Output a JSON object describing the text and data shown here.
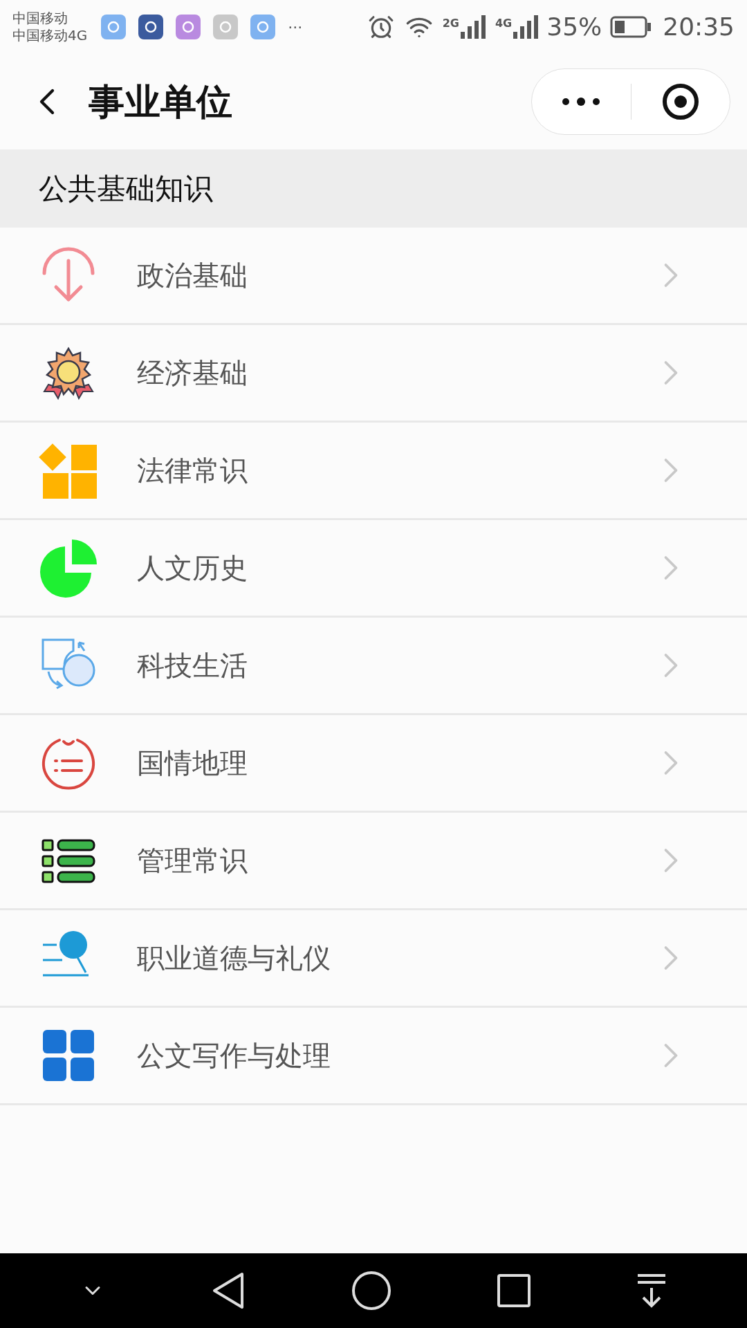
{
  "status_bar": {
    "carriers": [
      "中国移动",
      "中国移动4G"
    ],
    "more": "···",
    "networks": [
      "2G",
      "4G"
    ],
    "battery_text": "35%",
    "time": "20:35"
  },
  "nav_bar": {
    "title": "事业单位"
  },
  "section": {
    "title": "公共基础知识"
  },
  "items": [
    {
      "label": "政治基础",
      "kind": "arrow-down"
    },
    {
      "label": "经济基础",
      "kind": "medal"
    },
    {
      "label": "法律常识",
      "kind": "blocks"
    },
    {
      "label": "人文历史",
      "kind": "pie"
    },
    {
      "label": "科技生活",
      "kind": "shapes"
    },
    {
      "label": "国情地理",
      "kind": "timer-list"
    },
    {
      "label": "管理常识",
      "kind": "checklist"
    },
    {
      "label": "职业道德与礼仪",
      "kind": "search-lines"
    },
    {
      "label": "公文写作与处理",
      "kind": "grid"
    }
  ]
}
